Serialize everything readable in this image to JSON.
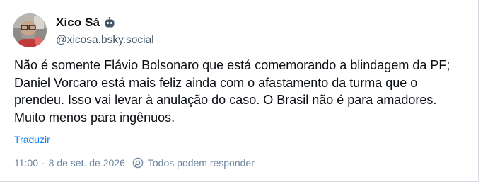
{
  "author": {
    "display_name": "Xico Sá",
    "handle": "@xicosa.bsky.social",
    "badge_icon": "bot-icon",
    "avatar_icon": "avatar-photo"
  },
  "post": {
    "text": "Não é somente Flávio Bolsonaro que está comemorando a blindagem da PF; Daniel Vorcaro está mais feliz ainda com o afastamento da turma que o prendeu. Isso vai levar à anulação do caso. O Brasil não é para amadores. Muito menos para ingênuos.",
    "translate_label": "Traduzir"
  },
  "meta": {
    "time": "11:00",
    "separator": "·",
    "date": "8 de set. de 2026",
    "reply_icon": "reply-settings-icon",
    "reply_setting": "Todos podem responder"
  },
  "colors": {
    "text": "#0b0f14",
    "secondary": "#42576c",
    "muted": "#6f869f",
    "link": "#1083fe"
  }
}
